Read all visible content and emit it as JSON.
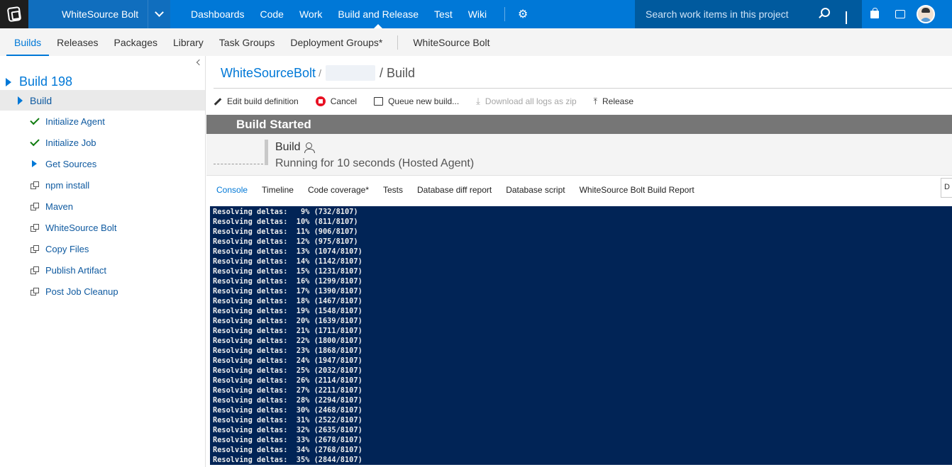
{
  "topbar": {
    "project": "WhiteSource Bolt",
    "hubs": [
      "Dashboards",
      "Code",
      "Work",
      "Build and Release",
      "Test",
      "Wiki"
    ],
    "active_hub": "Build and Release",
    "search_placeholder": "Search work items in this project"
  },
  "subnav": {
    "tabs": [
      "Builds",
      "Releases",
      "Packages",
      "Library",
      "Task Groups",
      "Deployment Groups*"
    ],
    "extra": "WhiteSource Bolt"
  },
  "left": {
    "build_title": "Build 198",
    "build_node": "Build",
    "steps": [
      {
        "label": "Initialize Agent",
        "status": "succeeded"
      },
      {
        "label": "Initialize Job",
        "status": "succeeded"
      },
      {
        "label": "Get Sources",
        "status": "running"
      },
      {
        "label": "npm install",
        "status": "pending"
      },
      {
        "label": "Maven",
        "status": "pending"
      },
      {
        "label": "WhiteSource Bolt",
        "status": "pending"
      },
      {
        "label": "Copy Files",
        "status": "pending"
      },
      {
        "label": "Publish Artifact",
        "status": "pending"
      },
      {
        "label": "Post Job Cleanup",
        "status": "pending"
      }
    ]
  },
  "breadcrumb": {
    "root": "WhiteSourceBolt",
    "sep": "/",
    "current": "/ Build"
  },
  "toolbar": {
    "edit": "Edit build definition",
    "cancel": "Cancel",
    "queue": "Queue new build...",
    "download": "Download all logs as zip",
    "release": "Release"
  },
  "status": {
    "title": "Build Started",
    "summary_title": "Build",
    "summary_sub": "Running for 10 seconds (Hosted Agent)"
  },
  "tabs": [
    "Console",
    "Timeline",
    "Code coverage*",
    "Tests",
    "Database diff report",
    "Database script",
    "WhiteSource Bolt Build Report"
  ],
  "tab_edge": "D",
  "console_lines": [
    "Resolving deltas:   9% (732/8107)",
    "Resolving deltas:  10% (811/8107)",
    "Resolving deltas:  11% (906/8107)",
    "Resolving deltas:  12% (975/8107)",
    "Resolving deltas:  13% (1074/8107)",
    "Resolving deltas:  14% (1142/8107)",
    "Resolving deltas:  15% (1231/8107)",
    "Resolving deltas:  16% (1299/8107)",
    "Resolving deltas:  17% (1390/8107)",
    "Resolving deltas:  18% (1467/8107)",
    "Resolving deltas:  19% (1548/8107)",
    "Resolving deltas:  20% (1639/8107)",
    "Resolving deltas:  21% (1711/8107)",
    "Resolving deltas:  22% (1800/8107)",
    "Resolving deltas:  23% (1868/8107)",
    "Resolving deltas:  24% (1947/8107)",
    "Resolving deltas:  25% (2032/8107)",
    "Resolving deltas:  26% (2114/8107)",
    "Resolving deltas:  27% (2211/8107)",
    "Resolving deltas:  28% (2294/8107)",
    "Resolving deltas:  30% (2468/8107)",
    "Resolving deltas:  31% (2522/8107)",
    "Resolving deltas:  32% (2635/8107)",
    "Resolving deltas:  33% (2678/8107)",
    "Resolving deltas:  34% (2768/8107)",
    "Resolving deltas:  35% (2844/8107)"
  ]
}
